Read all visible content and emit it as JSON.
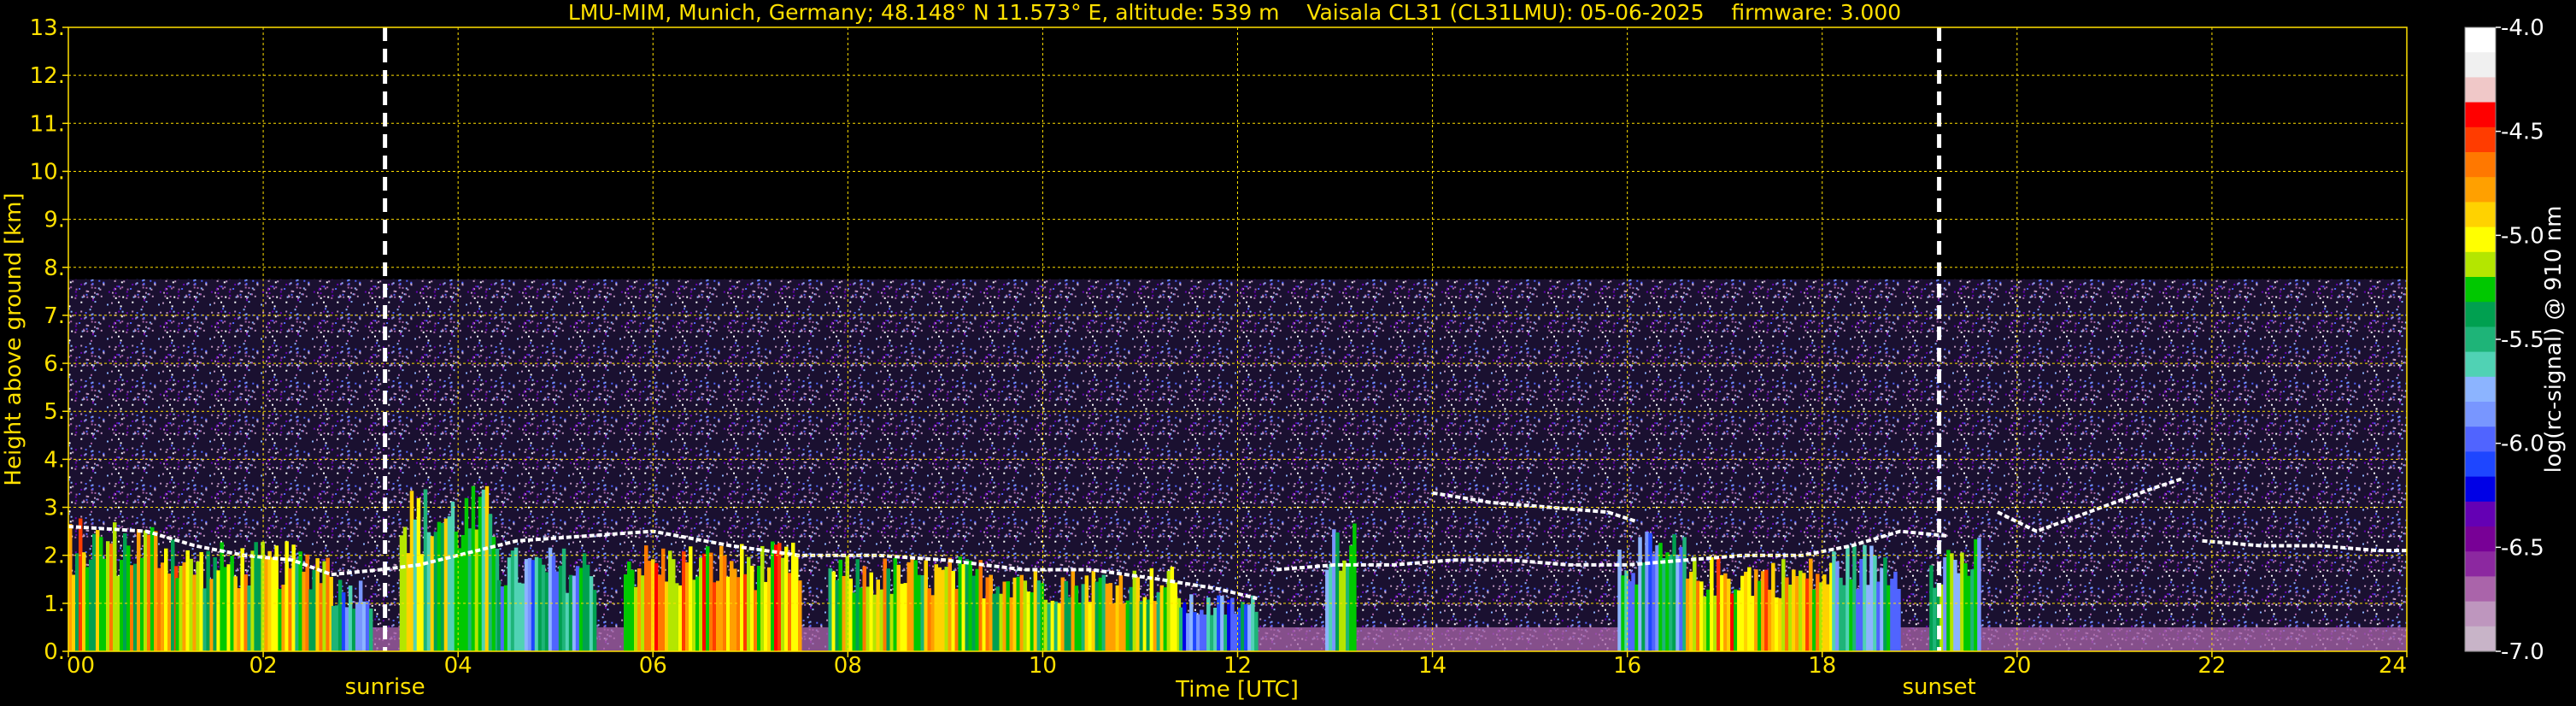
{
  "header": {
    "title": "LMU-MIM, Munich, Germany; 48.148° N 11.573° E, altitude: 539 m    Vaisala CL31 (CL31LMU): 05-06-2025    firmware: 3.000"
  },
  "colors": {
    "text": "#ffe000",
    "grid": "#ffe000",
    "background": "#000000",
    "sun_markers": "#ffffff"
  },
  "chart_data": {
    "type": "heatmap",
    "title": "LMU-MIM, Munich, Germany; 48.148° N 11.573° E, altitude: 539 m    Vaisala CL31 (CL31LMU): 05-06-2025    firmware: 3.000",
    "xlabel": "Time [UTC]",
    "ylabel": "Height above ground [km]",
    "xlim": [
      0,
      24
    ],
    "ylim": [
      0,
      13
    ],
    "x_ticks": [
      "00",
      "02",
      "04",
      "06",
      "08",
      "10",
      "12",
      "14",
      "16",
      "18",
      "20",
      "22",
      "24"
    ],
    "y_ticks": [
      "0.",
      "1.",
      "2.",
      "3.",
      "4.",
      "5.",
      "6.",
      "7.",
      "8.",
      "9.",
      "10.",
      "11.",
      "12.",
      "13."
    ],
    "grid": true,
    "colorbar": {
      "label": "log(rc-signal) @ 910 nm",
      "range": [
        -7.0,
        -4.0
      ],
      "ticks": [
        "-4.0",
        "-4.5",
        "-5.0",
        "-5.5",
        "-6.0",
        "-6.5",
        "-7.0"
      ],
      "colors": [
        "#ffffff",
        "#f0f0f0",
        "#f0c8c8",
        "#ff0000",
        "#ff3c00",
        "#ff7800",
        "#ffa000",
        "#ffd200",
        "#ffff00",
        "#b4e600",
        "#00c800",
        "#00a050",
        "#1eb478",
        "#50d2b4",
        "#8cb4ff",
        "#7896ff",
        "#5064ff",
        "#1e46ff",
        "#0000e6",
        "#6400b4",
        "#780096",
        "#8c28a0",
        "#aa64aa",
        "#be96be",
        "#c8b4c8"
      ]
    },
    "markers": [
      {
        "label": "sunrise",
        "x": 3.25
      },
      {
        "label": "sunset",
        "x": 19.2
      }
    ],
    "cloud_base_layers": [
      {
        "x": [
          0.0,
          0.8,
          1.3,
          1.8,
          2.3,
          2.7,
          3.2,
          3.6,
          4.0,
          4.6,
          5.3,
          6.0,
          6.8,
          7.5,
          8.3,
          9.0,
          9.8,
          10.5,
          11.2,
          11.8,
          12.2
        ],
        "y": [
          2.6,
          2.5,
          2.2,
          2.0,
          1.9,
          1.6,
          1.7,
          1.8,
          2.0,
          2.3,
          2.4,
          2.5,
          2.2,
          2.0,
          2.0,
          1.9,
          1.7,
          1.7,
          1.5,
          1.3,
          1.1
        ]
      },
      {
        "x": [
          12.4,
          13.0,
          13.6,
          14.2,
          14.8,
          15.4,
          16.0,
          16.6,
          17.2,
          17.8,
          18.3,
          18.8,
          19.3
        ],
        "y": [
          1.7,
          1.8,
          1.8,
          1.9,
          1.9,
          1.8,
          1.8,
          1.9,
          2.0,
          2.0,
          2.2,
          2.5,
          2.4
        ]
      },
      {
        "x": [
          14.0,
          14.6,
          15.2,
          15.8,
          16.1
        ],
        "y": [
          3.3,
          3.1,
          3.0,
          2.9,
          2.7
        ]
      },
      {
        "x": [
          19.8,
          20.2,
          20.6,
          21.0,
          21.4,
          21.7
        ],
        "y": [
          2.9,
          2.5,
          2.8,
          3.1,
          3.4,
          3.6
        ]
      },
      {
        "x": [
          21.9,
          22.5,
          23.1,
          23.7,
          24.0
        ],
        "y": [
          2.3,
          2.2,
          2.2,
          2.1,
          2.1
        ]
      }
    ],
    "aerosol_bursts": [
      {
        "x0": 0.0,
        "x1": 1.1,
        "top": 2.8,
        "level": -4.5
      },
      {
        "x0": 1.1,
        "x1": 2.7,
        "top": 2.3,
        "level": -4.6
      },
      {
        "x0": 2.7,
        "x1": 3.1,
        "top": 1.6,
        "level": -5.3
      },
      {
        "x0": 3.4,
        "x1": 4.4,
        "top": 3.5,
        "level": -4.8
      },
      {
        "x0": 4.4,
        "x1": 5.4,
        "top": 2.2,
        "level": -5.3
      },
      {
        "x0": 5.7,
        "x1": 7.5,
        "top": 2.3,
        "level": -4.4
      },
      {
        "x0": 7.8,
        "x1": 9.8,
        "top": 2.0,
        "level": -4.6
      },
      {
        "x0": 9.8,
        "x1": 11.4,
        "top": 1.8,
        "level": -4.7
      },
      {
        "x0": 11.4,
        "x1": 12.2,
        "top": 1.2,
        "level": -5.4
      },
      {
        "x0": 12.9,
        "x1": 13.2,
        "top": 3.0,
        "level": -5.0
      },
      {
        "x0": 15.9,
        "x1": 16.6,
        "top": 2.5,
        "level": -5.2
      },
      {
        "x0": 16.6,
        "x1": 18.1,
        "top": 2.0,
        "level": -4.4
      },
      {
        "x0": 18.1,
        "x1": 18.8,
        "top": 2.3,
        "level": -5.2
      },
      {
        "x0": 19.1,
        "x1": 19.6,
        "top": 2.4,
        "level": -5.0
      }
    ],
    "noise_top": 7.75
  }
}
